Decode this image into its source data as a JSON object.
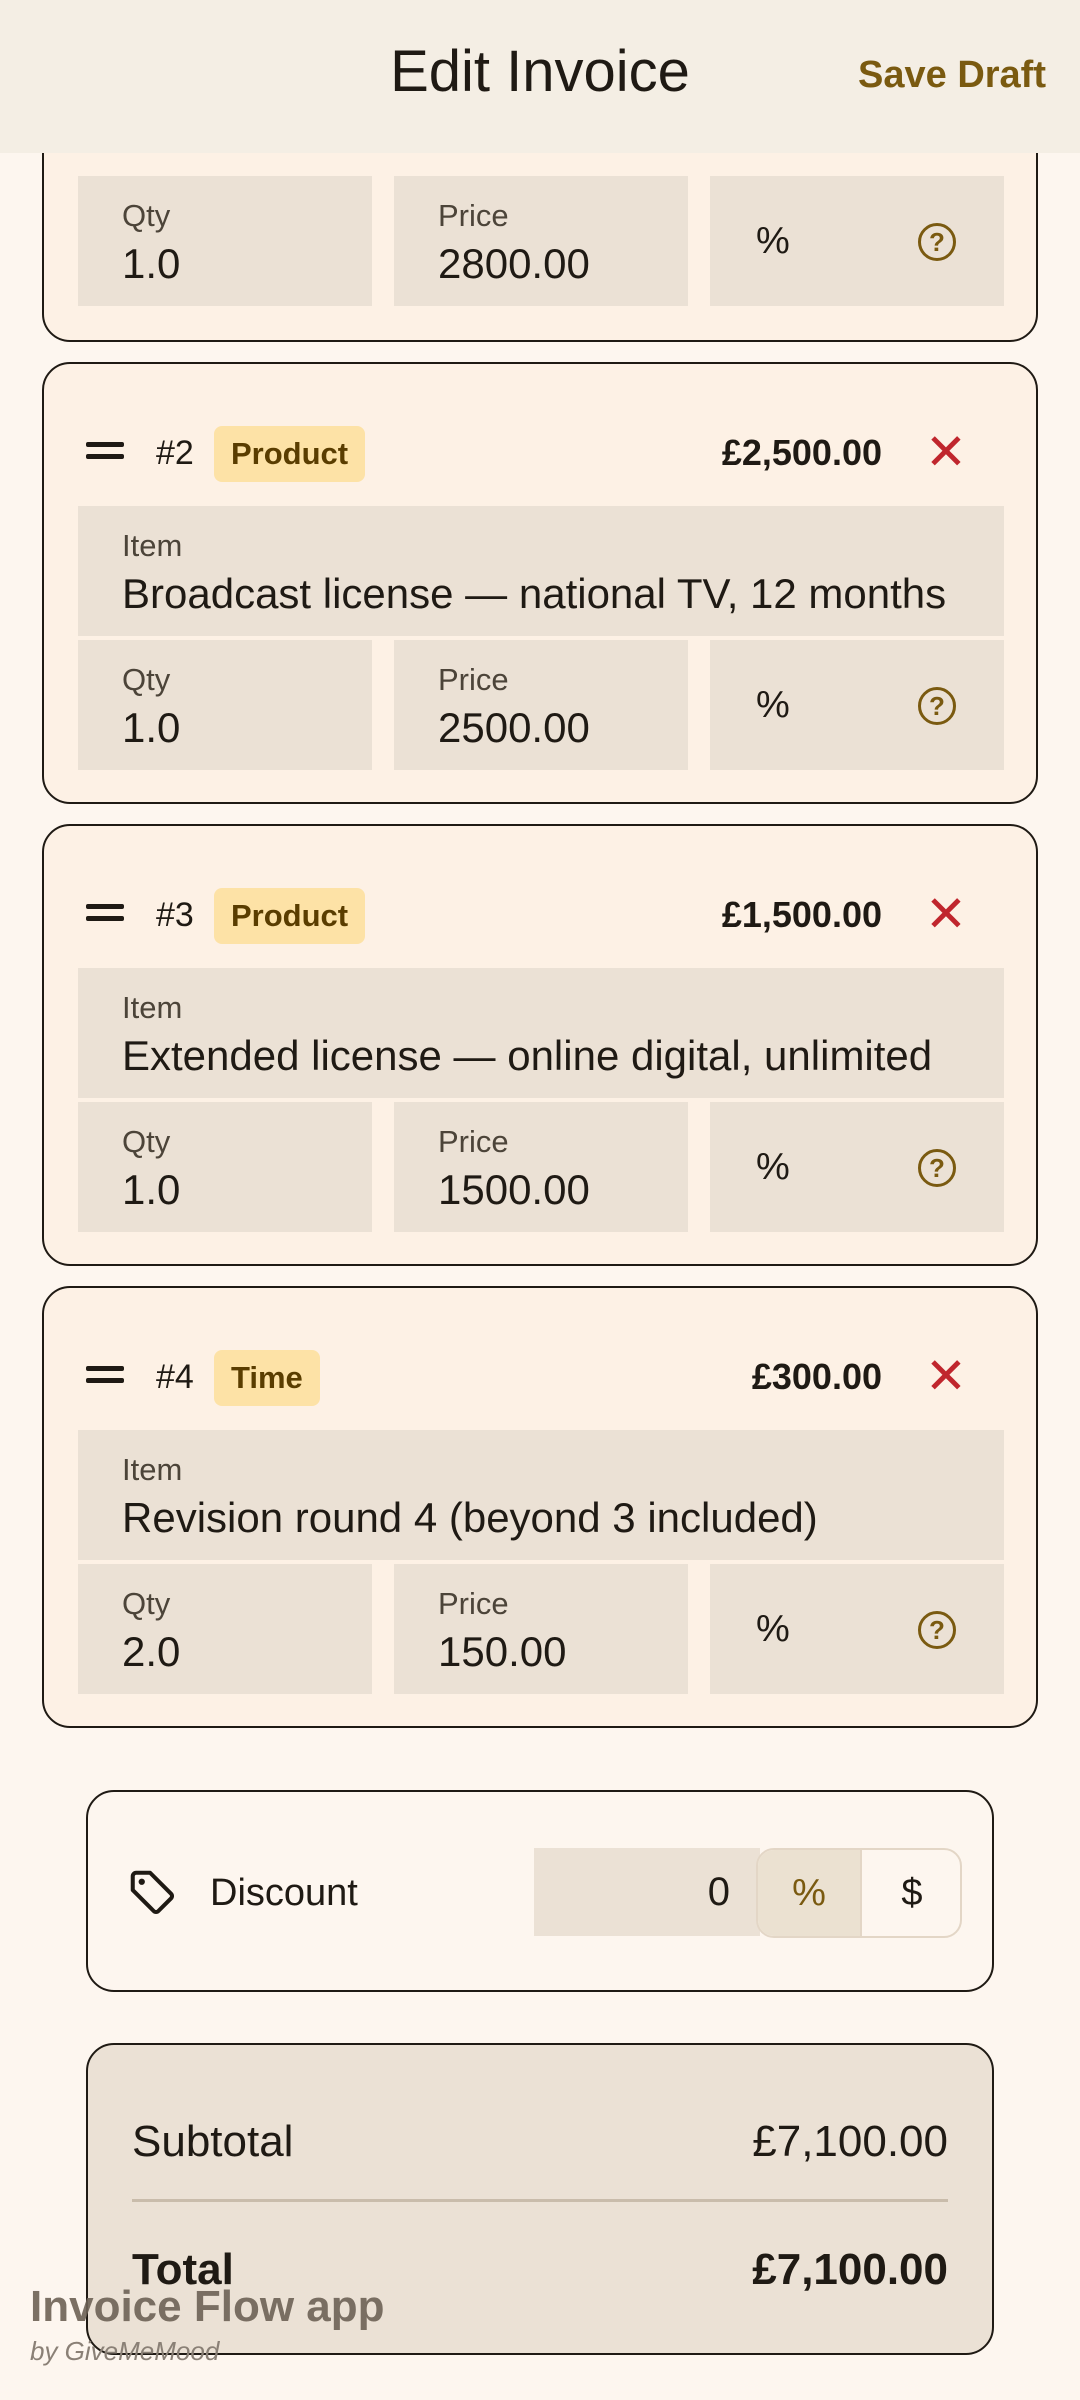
{
  "appbar": {
    "title": "Edit Invoice",
    "save_label": "Save Draft"
  },
  "field_labels": {
    "item": "Item",
    "qty": "Qty",
    "price": "Price",
    "percent": "%"
  },
  "partial_item": {
    "qty": "1.0",
    "price": "2800.00"
  },
  "items": [
    {
      "number": "#2",
      "type": "Product",
      "amount": "£2,500.00",
      "description": "Broadcast license — national TV, 12 months",
      "qty": "1.0",
      "price": "2500.00"
    },
    {
      "number": "#3",
      "type": "Product",
      "amount": "£1,500.00",
      "description": "Extended license — online digital, unlimited",
      "qty": "1.0",
      "price": "1500.00"
    },
    {
      "number": "#4",
      "type": "Time",
      "amount": "£300.00",
      "description": "Revision round 4 (beyond 3 included)",
      "qty": "2.0",
      "price": "150.00"
    }
  ],
  "icons": {
    "remove": "close-icon",
    "drag": "drag-handle-icon",
    "help": "help-circle-icon",
    "discount": "tag-icon"
  },
  "discount": {
    "label": "Discount",
    "value": "0",
    "options": [
      "%",
      "$"
    ],
    "selected": "%"
  },
  "totals": {
    "subtotal_label": "Subtotal",
    "subtotal": "£7,100.00",
    "total_label": "Total",
    "total": "£7,100.00"
  },
  "watermark": {
    "brand": "Invoice Flow app",
    "by": "by GiveMeMood"
  },
  "colors": {
    "accent": "#7a5a10",
    "danger": "#c0262d",
    "badge_bg": "#fde2a6",
    "field_bg": "#ebe1d5",
    "card_bg": "#fdf1e5"
  }
}
